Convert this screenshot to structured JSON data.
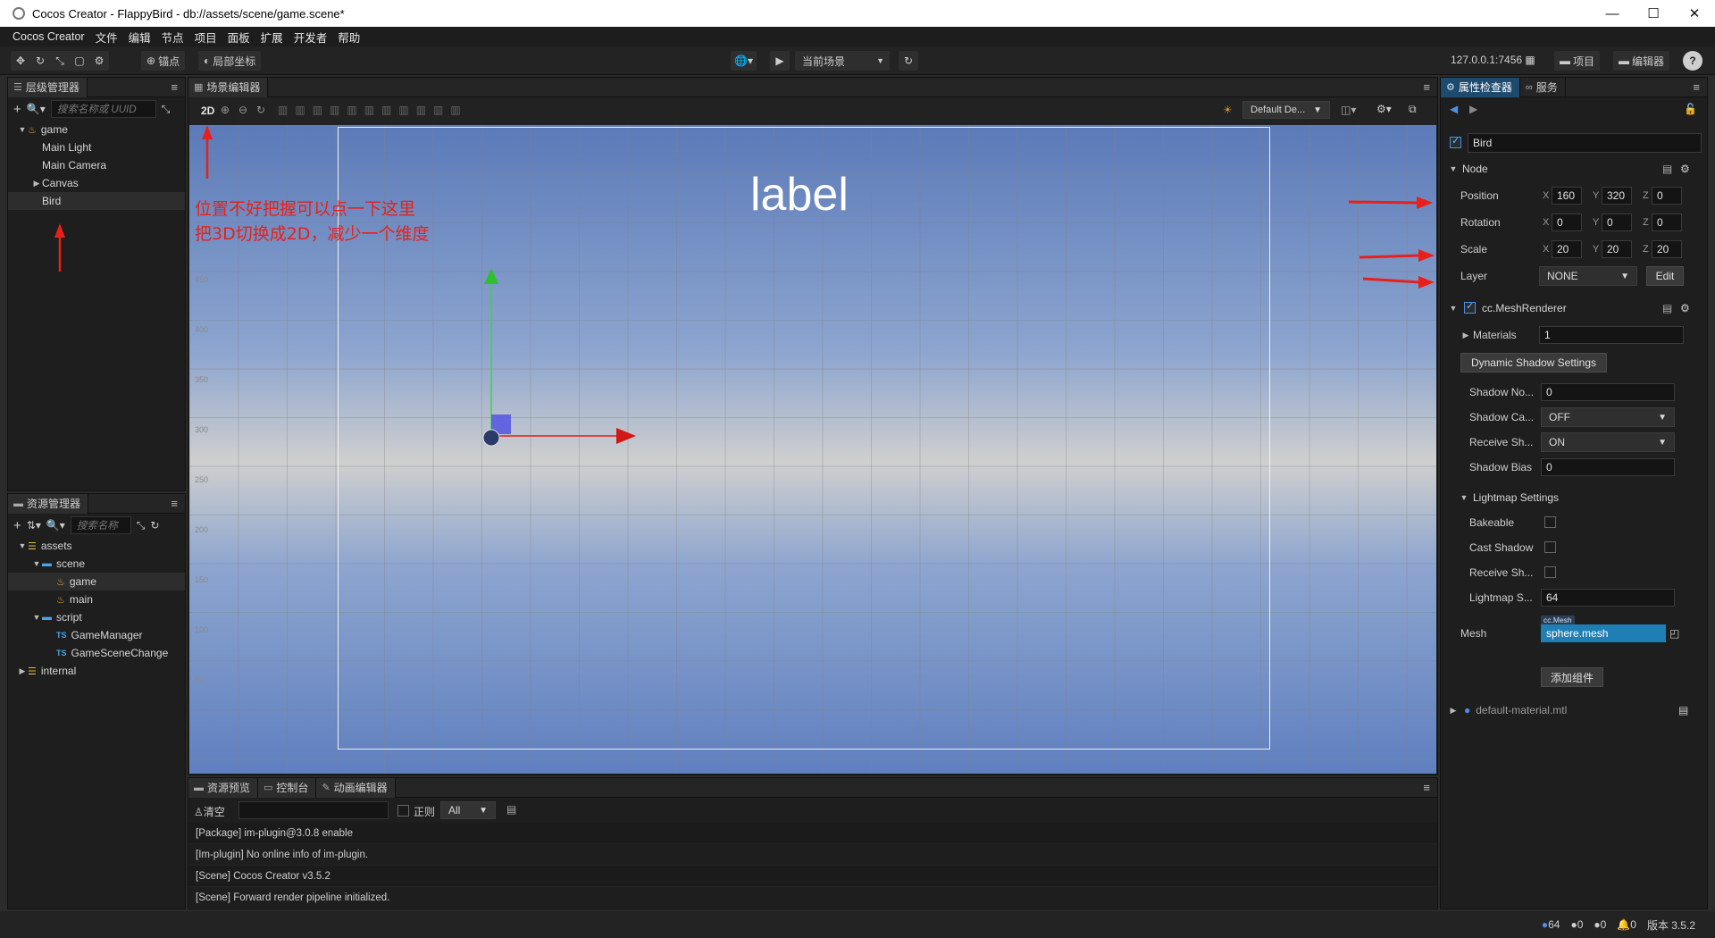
{
  "window": {
    "title": "Cocos Creator - FlappyBird - db://assets/scene/game.scene*",
    "minimize": "—",
    "maximize": "☐",
    "close": "✕"
  },
  "menu": [
    "Cocos Creator",
    "文件",
    "编辑",
    "节点",
    "项目",
    "面板",
    "扩展",
    "开发者",
    "帮助"
  ],
  "toolbar": {
    "pivot_label": "锚点",
    "local_label": "局部坐标",
    "scene_select": "当前场景",
    "ip": "127.0.0.1:7456",
    "project_btn": "项目",
    "editor_btn": "编辑器",
    "help": "?"
  },
  "hierarchy": {
    "tab": "层级管理器",
    "search_placeholder": "搜索名称或 UUID",
    "items": [
      {
        "label": "game",
        "level": 0,
        "caret": "▼",
        "icon": "scene"
      },
      {
        "label": "Main Light",
        "level": 1,
        "caret": "",
        "icon": ""
      },
      {
        "label": "Main Camera",
        "level": 1,
        "caret": "",
        "icon": ""
      },
      {
        "label": "Canvas",
        "level": 1,
        "caret": "▶",
        "icon": ""
      },
      {
        "label": "Bird",
        "level": 1,
        "caret": "",
        "icon": "",
        "selected": true
      }
    ]
  },
  "assets": {
    "tab": "资源管理器",
    "search_placeholder": "搜索名称",
    "items": [
      {
        "label": "assets",
        "level": 0,
        "caret": "▼",
        "icon": "db"
      },
      {
        "label": "scene",
        "level": 1,
        "caret": "▼",
        "icon": "folder"
      },
      {
        "label": "game",
        "level": 2,
        "caret": "",
        "icon": "scene",
        "selected": true
      },
      {
        "label": "main",
        "level": 2,
        "caret": "",
        "icon": "scene"
      },
      {
        "label": "script",
        "level": 1,
        "caret": "▼",
        "icon": "folder"
      },
      {
        "label": "GameManager",
        "level": 2,
        "caret": "",
        "icon": "ts"
      },
      {
        "label": "GameSceneChange",
        "level": 2,
        "caret": "",
        "icon": "ts"
      },
      {
        "label": "internal",
        "level": 0,
        "caret": "▶",
        "icon": "db"
      }
    ]
  },
  "scene": {
    "tab": "场景编辑器",
    "mode": "2D",
    "camera_select": "Default De...",
    "label_text": "label",
    "ruler": [
      "500",
      "450",
      "400",
      "350",
      "300",
      "250",
      "200",
      "150",
      "100",
      "50"
    ],
    "annotation": [
      "位置不好把握可以点一下这里",
      "把3D切换成2D，减少一个维度"
    ]
  },
  "console": {
    "tabs": [
      "资源预览",
      "控制台",
      "动画编辑器"
    ],
    "clear": "清空",
    "regex": "正则",
    "filter": "All",
    "lines": [
      "[Package] im-plugin@3.0.8 enable",
      "[Im-plugin] No online info of im-plugin.",
      "[Scene] Cocos Creator v3.5.2",
      "[Scene] Forward render pipeline initialized."
    ]
  },
  "inspector": {
    "tabs": [
      "属性检查器",
      "服务"
    ],
    "node_name": "Bird",
    "node_section": "Node",
    "position": {
      "label": "Position",
      "x": "160",
      "y": "320",
      "z": "0"
    },
    "rotation": {
      "label": "Rotation",
      "x": "0",
      "y": "0",
      "z": "0"
    },
    "scale": {
      "label": "Scale",
      "x": "20",
      "y": "20",
      "z": "20"
    },
    "layer": {
      "label": "Layer",
      "value": "NONE",
      "edit": "Edit"
    },
    "axes": {
      "x": "X",
      "y": "Y",
      "z": "Z"
    },
    "mesh_renderer": "cc.MeshRenderer",
    "materials": {
      "label": "Materials",
      "value": "1"
    },
    "dynamic_shadow": "Dynamic Shadow Settings",
    "shadow_normal_bias": {
      "label": "Shadow No...",
      "value": "0"
    },
    "shadow_cast": {
      "label": "Shadow Ca...",
      "value": "OFF"
    },
    "receive_shadow": {
      "label": "Receive Sh...",
      "value": "ON"
    },
    "shadow_bias": {
      "label": "Shadow Bias",
      "value": "0"
    },
    "lightmap": "Lightmap Settings",
    "bakeable": "Bakeable",
    "cast_shadow": "Cast Shadow",
    "receive_sh2": "Receive Sh...",
    "lightmap_size": {
      "label": "Lightmap S...",
      "value": "64"
    },
    "mesh": {
      "label": "Mesh",
      "type": "cc.Mesh",
      "value": "sphere.mesh"
    },
    "add_component": "添加组件",
    "material_asset": "default-material.mtl"
  },
  "status": {
    "info": "64",
    "warn": "0",
    "err": "0",
    "bell": "0",
    "version": "版本 3.5.2"
  },
  "colors": {
    "accent": "#1e4a6e",
    "annotation": "#e8201a",
    "mesh_field": "#1f7fb5"
  }
}
